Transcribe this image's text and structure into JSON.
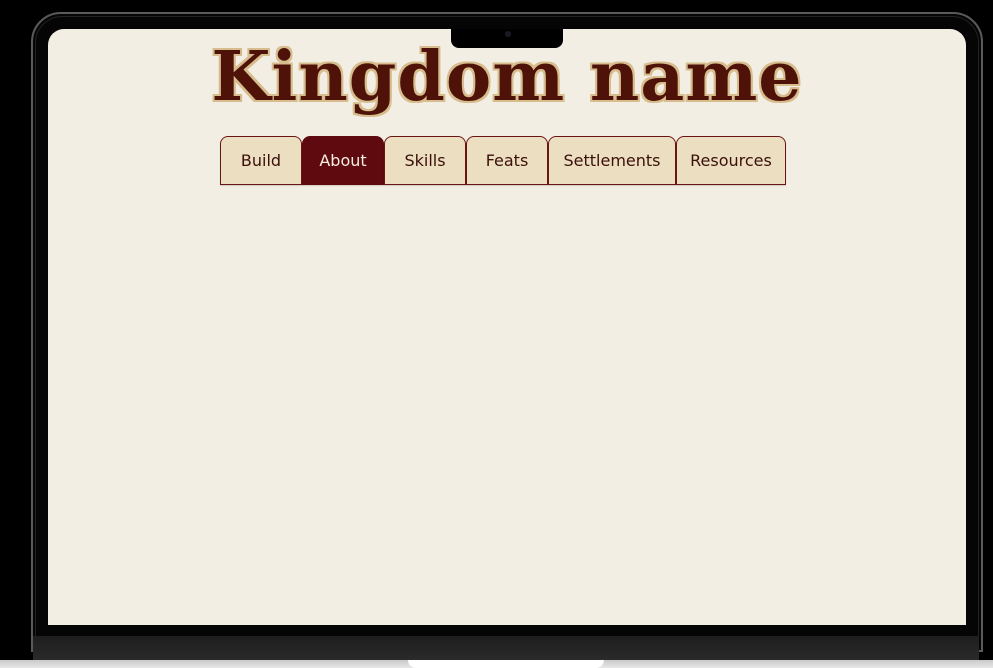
{
  "app": {
    "title": "Kingdom name"
  },
  "tabs": [
    {
      "label": "Build",
      "active": false
    },
    {
      "label": "About",
      "active": true
    },
    {
      "label": "Skills",
      "active": false
    },
    {
      "label": "Feats",
      "active": false
    },
    {
      "label": "Settlements",
      "active": false
    },
    {
      "label": "Resources",
      "active": false
    }
  ],
  "colors": {
    "page_background": "#f3eee3",
    "title_text": "#4f1209",
    "title_outline": "#d7bd8e",
    "tab_background": "#ecdfc1",
    "tab_border": "#6a1515",
    "tab_active_background": "#5e0a0e",
    "tab_active_text": "#f7eee0",
    "tab_text": "#3b0f0a"
  }
}
